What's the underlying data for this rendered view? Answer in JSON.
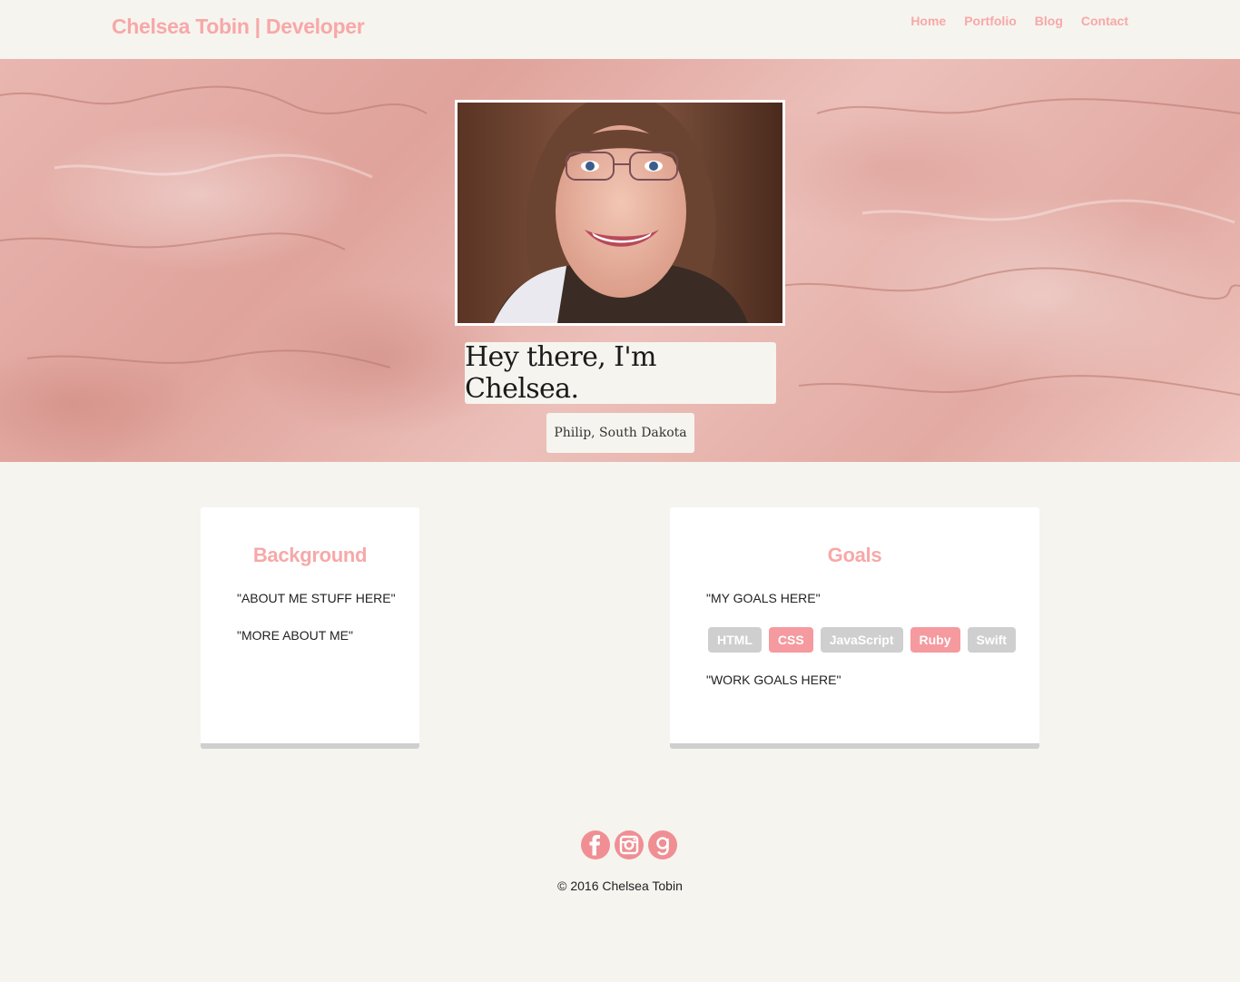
{
  "header": {
    "brand": "Chelsea Tobin | Developer",
    "nav": [
      "Home",
      "Portfolio",
      "Blog",
      "Contact"
    ]
  },
  "hero": {
    "greeting": "Hey there, I'm Chelsea.",
    "location": "Philip, South Dakota"
  },
  "background_card": {
    "title": "Background",
    "lines": [
      "\"ABOUT ME STUFF HERE\"",
      "\"MORE ABOUT ME\""
    ]
  },
  "goals_card": {
    "title": "Goals",
    "intro": "\"MY GOALS HERE\"",
    "skills": [
      {
        "label": "HTML",
        "color": "#cfcfcf"
      },
      {
        "label": "CSS",
        "color": "#f59a9f"
      },
      {
        "label": "JavaScript",
        "color": "#cfcfcf"
      },
      {
        "label": "Ruby",
        "color": "#f59a9f"
      },
      {
        "label": "Swift",
        "color": "#cfcfcf"
      }
    ],
    "work": "\"WORK GOALS HERE\""
  },
  "footer": {
    "social_icons": [
      "facebook-icon",
      "instagram-icon",
      "goodreads-icon"
    ],
    "copyright": "© 2016 Chelsea Tobin"
  },
  "colors": {
    "accent": "#f7a8a8",
    "page_bg": "#f6f4ef",
    "social_bg": "#ef8f94"
  }
}
